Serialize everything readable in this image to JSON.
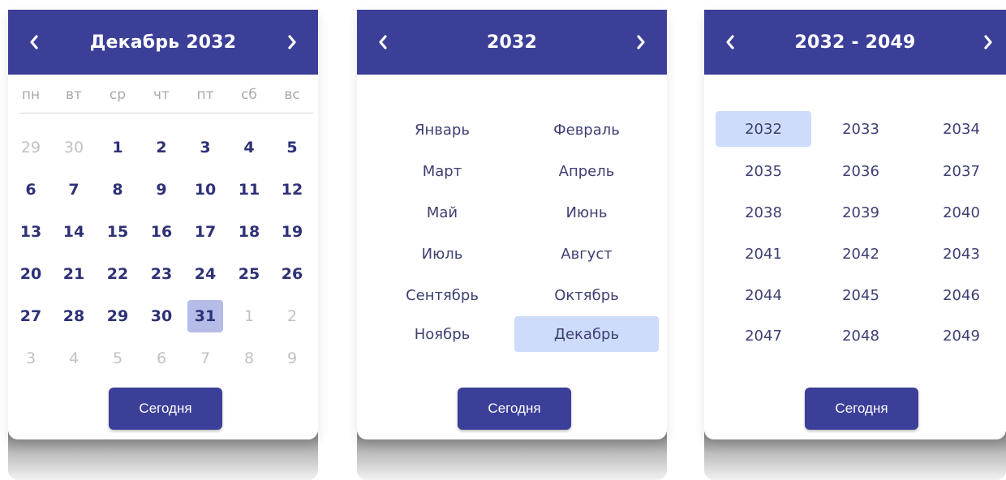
{
  "colors": {
    "header_bg": "#3b3f98",
    "header_text": "#ffffff",
    "day_text": "#2e3176",
    "muted_text": "#c2c2c2",
    "selected_day_bg": "#b6bce8",
    "selected_item_bg": "#cddcfb",
    "button_bg": "#3b3f98"
  },
  "day_view": {
    "title": "Декабрь 2032",
    "weekdays": [
      "пн",
      "вт",
      "ср",
      "чт",
      "пт",
      "сб",
      "вс"
    ],
    "weeks": [
      [
        "29",
        "30",
        "1",
        "2",
        "3",
        "4",
        "5"
      ],
      [
        "6",
        "7",
        "8",
        "9",
        "10",
        "11",
        "12"
      ],
      [
        "13",
        "14",
        "15",
        "16",
        "17",
        "18",
        "19"
      ],
      [
        "20",
        "21",
        "22",
        "23",
        "24",
        "25",
        "26"
      ],
      [
        "27",
        "28",
        "29",
        "30",
        "31",
        "1",
        "2"
      ],
      [
        "3",
        "4",
        "5",
        "6",
        "7",
        "8",
        "9"
      ]
    ],
    "selected_day": "31",
    "today_label": "Сегодня",
    "prev_icon": "chevron-left-icon",
    "next_icon": "chevron-right-icon"
  },
  "month_view": {
    "title": "2032",
    "months": [
      "Январь",
      "Февраль",
      "Март",
      "Апрель",
      "Май",
      "Июнь",
      "Июль",
      "Август",
      "Сентябрь",
      "Октябрь",
      "Ноябрь",
      "Декабрь"
    ],
    "selected_month": "Декабрь",
    "today_label": "Сегодня"
  },
  "year_view": {
    "title": "2032 - 2049",
    "years": [
      "2032",
      "2033",
      "2034",
      "2035",
      "2036",
      "2037",
      "2038",
      "2039",
      "2040",
      "2041",
      "2042",
      "2043",
      "2044",
      "2045",
      "2046",
      "2047",
      "2048",
      "2049"
    ],
    "selected_year": "2032",
    "today_label": "Сегодня"
  }
}
